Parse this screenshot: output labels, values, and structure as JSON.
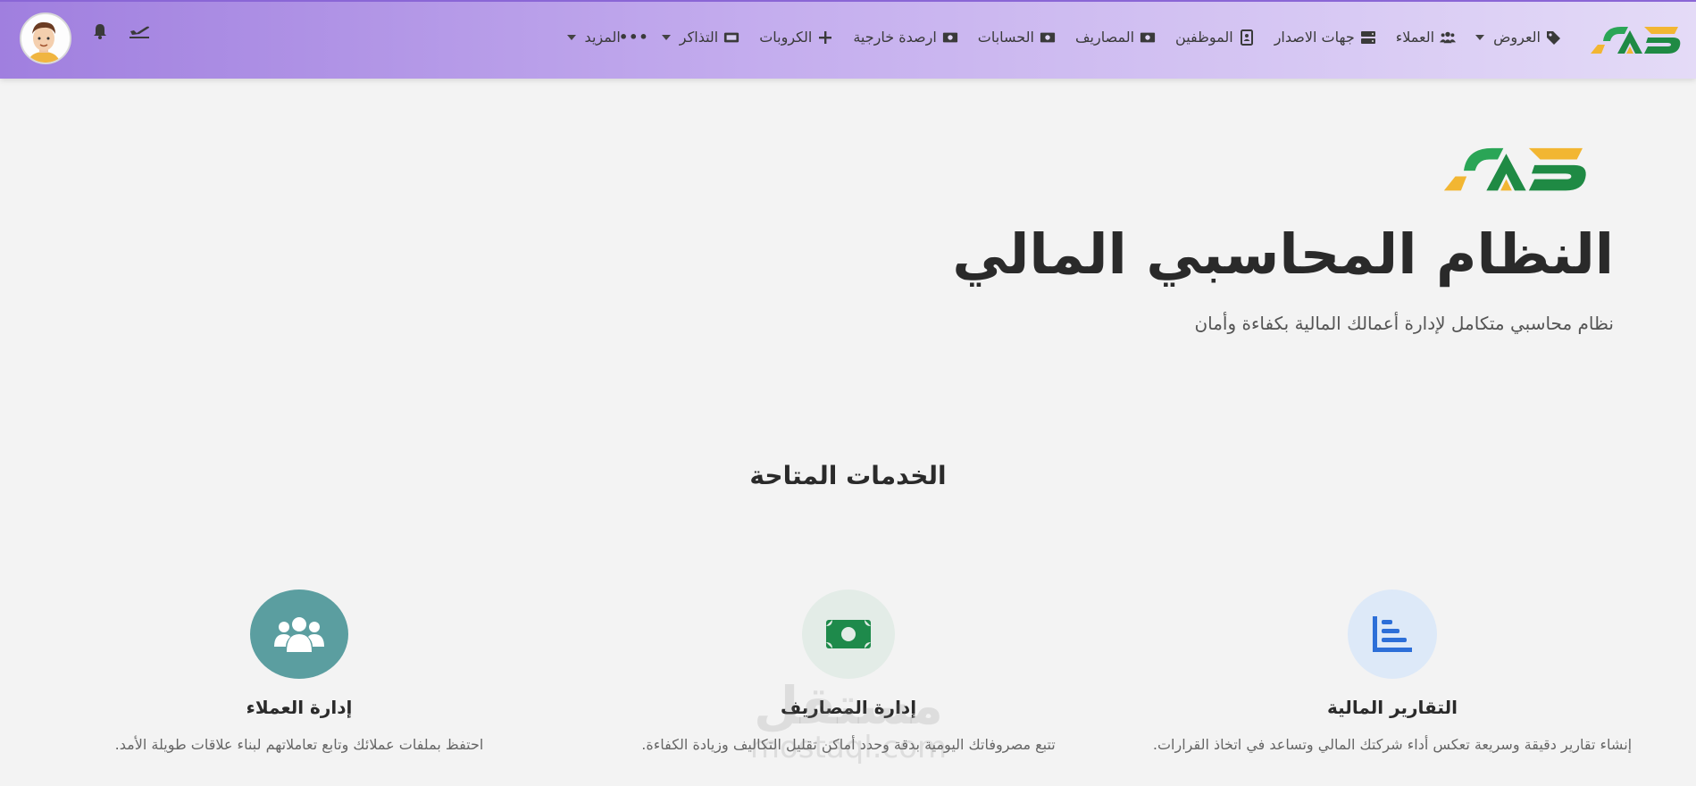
{
  "colors": {
    "navbar_start": "#a07fdf",
    "navbar_end": "#e4dbf7",
    "logo_green": "#1f9a4a",
    "logo_yellow": "#f2b632",
    "clients_circle": "#5b9ea0",
    "expenses_circle": "#e3ece7",
    "expenses_icon": "#1e8a4b",
    "reports_circle": "#dde9f8",
    "reports_icon": "#2d6fd8"
  },
  "navbar": {
    "items": [
      {
        "label": "العروض",
        "icon": "tags-icon",
        "dropdown": true
      },
      {
        "label": "العملاء",
        "icon": "users-icon",
        "dropdown": false
      },
      {
        "label": "جهات الاصدار",
        "icon": "server-icon",
        "dropdown": false
      },
      {
        "label": "الموظفين",
        "icon": "id-card-icon",
        "dropdown": false
      },
      {
        "label": "المصاريف",
        "icon": "money-icon",
        "dropdown": false
      },
      {
        "label": "الحسابات",
        "icon": "money-icon",
        "dropdown": false
      },
      {
        "label": "ارصدة خارجية",
        "icon": "money-icon",
        "dropdown": false
      },
      {
        "label": "الكروبات",
        "icon": "plus-icon",
        "dropdown": false
      },
      {
        "label": "التذاكر",
        "icon": "ticket-icon",
        "dropdown": true
      },
      {
        "label": "المزيد",
        "icon": "ellipsis-icon",
        "dropdown": true
      }
    ]
  },
  "hero": {
    "title": "النظام المحاسبي المالي",
    "subtitle": "نظام محاسبي متكامل لإدارة أعمالك المالية بكفاءة وأمان"
  },
  "services": {
    "heading": "الخدمات المتاحة",
    "items": [
      {
        "title": "التقارير المالية",
        "desc": "إنشاء تقارير دقيقة وسريعة تعكس أداء شركتك المالي وتساعد في اتخاذ القرارات.",
        "icon": "chart-icon"
      },
      {
        "title": "إدارة المصاريف",
        "desc": "تتبع مصروفاتك اليومية بدقة وحدد أماكن تقليل التكاليف وزيادة الكفاءة.",
        "icon": "money-icon"
      },
      {
        "title": "إدارة العملاء",
        "desc": "احتفظ بملفات عملائك وتابع تعاملاتهم لبناء علاقات طويلة الأمد.",
        "icon": "users-icon"
      }
    ]
  },
  "watermark": {
    "big": "مستقل",
    "small": "mostaql.com"
  }
}
